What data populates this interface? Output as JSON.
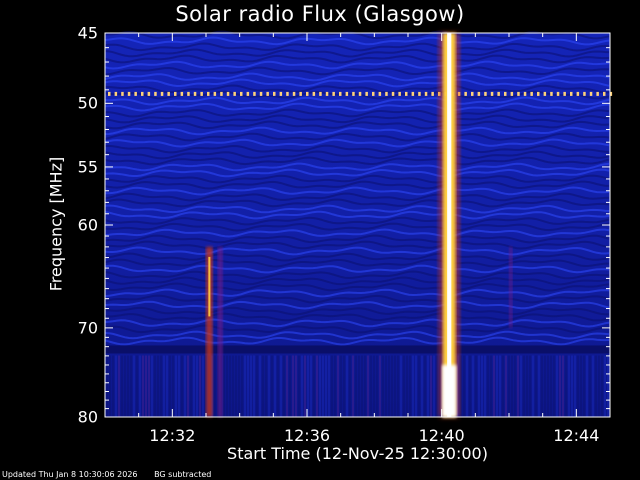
{
  "chart_data": {
    "type": "heatmap",
    "title": "Solar radio Flux (Glasgow)",
    "xlabel": "Start Time (12-Nov-25 12:30:00)",
    "ylabel": "Frequency [MHz]",
    "x_ticks": [
      "12:32",
      "12:36",
      "12:40",
      "12:44"
    ],
    "x_tick_minutes": [
      2,
      6,
      10,
      14
    ],
    "xlim_minutes": [
      0,
      15
    ],
    "y_ticks": [
      45,
      50,
      55,
      60,
      70,
      80
    ],
    "ylim_mhz": [
      45,
      80
    ],
    "y_scale": "log",
    "colormap": [
      "#0a0a6e",
      "#1a2acc",
      "#7a1f8a",
      "#e03a10",
      "#ffd040",
      "#ffffff"
    ],
    "bursts": [
      {
        "start_minute": 10.1,
        "end_minute": 10.35,
        "freq_low": 45,
        "freq_high": 80,
        "intensity": 1.0
      },
      {
        "start_minute": 3.0,
        "end_minute": 3.2,
        "freq_low": 62,
        "freq_high": 80,
        "intensity": 0.6
      },
      {
        "start_minute": 3.35,
        "end_minute": 3.5,
        "freq_low": 62,
        "freq_high": 80,
        "intensity": 0.35
      },
      {
        "start_minute": 12.0,
        "end_minute": 12.1,
        "freq_low": 62,
        "freq_high": 70,
        "intensity": 0.25
      }
    ],
    "interference_bands_mhz": [
      49.3,
      72.3
    ]
  },
  "footer": {
    "updated": "Updated Thu Jan  8 10:30:06 2026",
    "note": "BG subtracted"
  }
}
